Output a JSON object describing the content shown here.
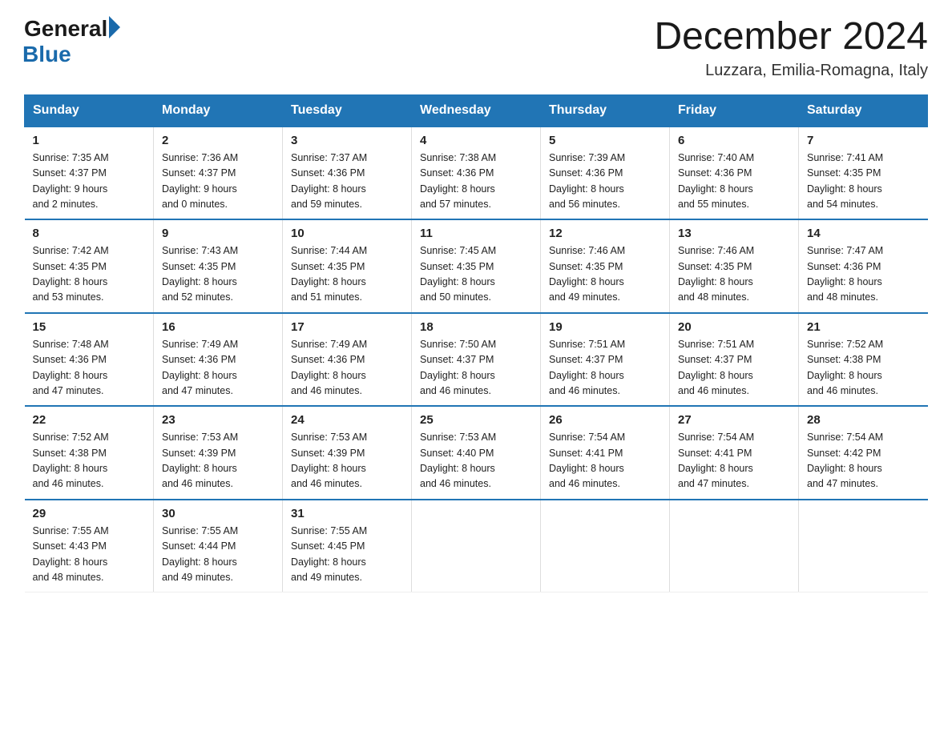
{
  "logo": {
    "general": "General",
    "blue": "Blue"
  },
  "title": "December 2024",
  "subtitle": "Luzzara, Emilia-Romagna, Italy",
  "days_of_week": [
    "Sunday",
    "Monday",
    "Tuesday",
    "Wednesday",
    "Thursday",
    "Friday",
    "Saturday"
  ],
  "weeks": [
    [
      {
        "day": "1",
        "sunrise": "7:35 AM",
        "sunset": "4:37 PM",
        "daylight": "9 hours and 2 minutes."
      },
      {
        "day": "2",
        "sunrise": "7:36 AM",
        "sunset": "4:37 PM",
        "daylight": "9 hours and 0 minutes."
      },
      {
        "day": "3",
        "sunrise": "7:37 AM",
        "sunset": "4:36 PM",
        "daylight": "8 hours and 59 minutes."
      },
      {
        "day": "4",
        "sunrise": "7:38 AM",
        "sunset": "4:36 PM",
        "daylight": "8 hours and 57 minutes."
      },
      {
        "day": "5",
        "sunrise": "7:39 AM",
        "sunset": "4:36 PM",
        "daylight": "8 hours and 56 minutes."
      },
      {
        "day": "6",
        "sunrise": "7:40 AM",
        "sunset": "4:36 PM",
        "daylight": "8 hours and 55 minutes."
      },
      {
        "day": "7",
        "sunrise": "7:41 AM",
        "sunset": "4:35 PM",
        "daylight": "8 hours and 54 minutes."
      }
    ],
    [
      {
        "day": "8",
        "sunrise": "7:42 AM",
        "sunset": "4:35 PM",
        "daylight": "8 hours and 53 minutes."
      },
      {
        "day": "9",
        "sunrise": "7:43 AM",
        "sunset": "4:35 PM",
        "daylight": "8 hours and 52 minutes."
      },
      {
        "day": "10",
        "sunrise": "7:44 AM",
        "sunset": "4:35 PM",
        "daylight": "8 hours and 51 minutes."
      },
      {
        "day": "11",
        "sunrise": "7:45 AM",
        "sunset": "4:35 PM",
        "daylight": "8 hours and 50 minutes."
      },
      {
        "day": "12",
        "sunrise": "7:46 AM",
        "sunset": "4:35 PM",
        "daylight": "8 hours and 49 minutes."
      },
      {
        "day": "13",
        "sunrise": "7:46 AM",
        "sunset": "4:35 PM",
        "daylight": "8 hours and 48 minutes."
      },
      {
        "day": "14",
        "sunrise": "7:47 AM",
        "sunset": "4:36 PM",
        "daylight": "8 hours and 48 minutes."
      }
    ],
    [
      {
        "day": "15",
        "sunrise": "7:48 AM",
        "sunset": "4:36 PM",
        "daylight": "8 hours and 47 minutes."
      },
      {
        "day": "16",
        "sunrise": "7:49 AM",
        "sunset": "4:36 PM",
        "daylight": "8 hours and 47 minutes."
      },
      {
        "day": "17",
        "sunrise": "7:49 AM",
        "sunset": "4:36 PM",
        "daylight": "8 hours and 46 minutes."
      },
      {
        "day": "18",
        "sunrise": "7:50 AM",
        "sunset": "4:37 PM",
        "daylight": "8 hours and 46 minutes."
      },
      {
        "day": "19",
        "sunrise": "7:51 AM",
        "sunset": "4:37 PM",
        "daylight": "8 hours and 46 minutes."
      },
      {
        "day": "20",
        "sunrise": "7:51 AM",
        "sunset": "4:37 PM",
        "daylight": "8 hours and 46 minutes."
      },
      {
        "day": "21",
        "sunrise": "7:52 AM",
        "sunset": "4:38 PM",
        "daylight": "8 hours and 46 minutes."
      }
    ],
    [
      {
        "day": "22",
        "sunrise": "7:52 AM",
        "sunset": "4:38 PM",
        "daylight": "8 hours and 46 minutes."
      },
      {
        "day": "23",
        "sunrise": "7:53 AM",
        "sunset": "4:39 PM",
        "daylight": "8 hours and 46 minutes."
      },
      {
        "day": "24",
        "sunrise": "7:53 AM",
        "sunset": "4:39 PM",
        "daylight": "8 hours and 46 minutes."
      },
      {
        "day": "25",
        "sunrise": "7:53 AM",
        "sunset": "4:40 PM",
        "daylight": "8 hours and 46 minutes."
      },
      {
        "day": "26",
        "sunrise": "7:54 AM",
        "sunset": "4:41 PM",
        "daylight": "8 hours and 46 minutes."
      },
      {
        "day": "27",
        "sunrise": "7:54 AM",
        "sunset": "4:41 PM",
        "daylight": "8 hours and 47 minutes."
      },
      {
        "day": "28",
        "sunrise": "7:54 AM",
        "sunset": "4:42 PM",
        "daylight": "8 hours and 47 minutes."
      }
    ],
    [
      {
        "day": "29",
        "sunrise": "7:55 AM",
        "sunset": "4:43 PM",
        "daylight": "8 hours and 48 minutes."
      },
      {
        "day": "30",
        "sunrise": "7:55 AM",
        "sunset": "4:44 PM",
        "daylight": "8 hours and 49 minutes."
      },
      {
        "day": "31",
        "sunrise": "7:55 AM",
        "sunset": "4:45 PM",
        "daylight": "8 hours and 49 minutes."
      },
      null,
      null,
      null,
      null
    ]
  ],
  "labels": {
    "sunrise": "Sunrise:",
    "sunset": "Sunset:",
    "daylight": "Daylight:"
  }
}
